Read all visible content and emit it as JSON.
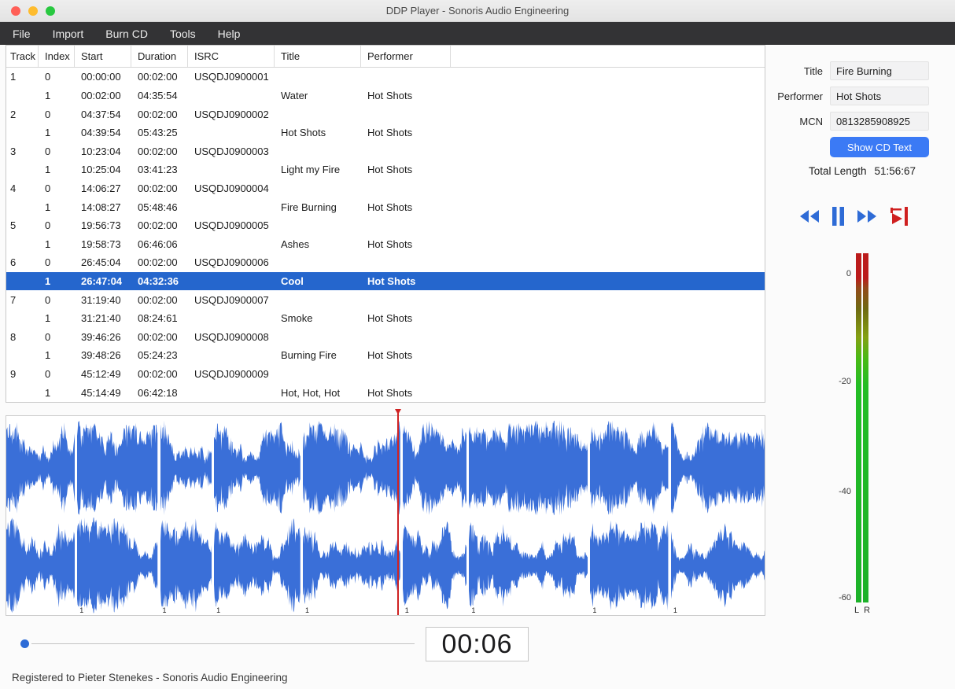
{
  "window": {
    "title": "DDP Player - Sonoris Audio Engineering"
  },
  "menu": {
    "items": [
      "File",
      "Import",
      "Burn CD",
      "Tools",
      "Help"
    ]
  },
  "table": {
    "columns": [
      "Track",
      "Index",
      "Start",
      "Duration",
      "ISRC",
      "Title",
      "Performer"
    ],
    "rows": [
      {
        "track": "1",
        "index": "0",
        "start": "00:00:00",
        "duration": "00:02:00",
        "isrc": "USQDJ0900001",
        "title": "",
        "performer": "",
        "selected": false
      },
      {
        "track": "",
        "index": "1",
        "start": "00:02:00",
        "duration": "04:35:54",
        "isrc": "",
        "title": "Water",
        "performer": "Hot Shots",
        "selected": false
      },
      {
        "track": "2",
        "index": "0",
        "start": "04:37:54",
        "duration": "00:02:00",
        "isrc": "USQDJ0900002",
        "title": "",
        "performer": "",
        "selected": false
      },
      {
        "track": "",
        "index": "1",
        "start": "04:39:54",
        "duration": "05:43:25",
        "isrc": "",
        "title": "Hot Shots",
        "performer": "Hot Shots",
        "selected": false
      },
      {
        "track": "3",
        "index": "0",
        "start": "10:23:04",
        "duration": "00:02:00",
        "isrc": "USQDJ0900003",
        "title": "",
        "performer": "",
        "selected": false
      },
      {
        "track": "",
        "index": "1",
        "start": "10:25:04",
        "duration": "03:41:23",
        "isrc": "",
        "title": "Light my Fire",
        "performer": "Hot Shots",
        "selected": false
      },
      {
        "track": "4",
        "index": "0",
        "start": "14:06:27",
        "duration": "00:02:00",
        "isrc": "USQDJ0900004",
        "title": "",
        "performer": "",
        "selected": false
      },
      {
        "track": "",
        "index": "1",
        "start": "14:08:27",
        "duration": "05:48:46",
        "isrc": "",
        "title": "Fire Burning",
        "performer": "Hot Shots",
        "selected": false
      },
      {
        "track": "5",
        "index": "0",
        "start": "19:56:73",
        "duration": "00:02:00",
        "isrc": "USQDJ0900005",
        "title": "",
        "performer": "",
        "selected": false
      },
      {
        "track": "",
        "index": "1",
        "start": "19:58:73",
        "duration": "06:46:06",
        "isrc": "",
        "title": "Ashes",
        "performer": "Hot Shots",
        "selected": false
      },
      {
        "track": "6",
        "index": "0",
        "start": "26:45:04",
        "duration": "00:02:00",
        "isrc": "USQDJ0900006",
        "title": "",
        "performer": "",
        "selected": false
      },
      {
        "track": "",
        "index": "1",
        "start": "26:47:04",
        "duration": "04:32:36",
        "isrc": "",
        "title": "Cool",
        "performer": "Hot Shots",
        "selected": true
      },
      {
        "track": "7",
        "index": "0",
        "start": "31:19:40",
        "duration": "00:02:00",
        "isrc": "USQDJ0900007",
        "title": "",
        "performer": "",
        "selected": false
      },
      {
        "track": "",
        "index": "1",
        "start": "31:21:40",
        "duration": "08:24:61",
        "isrc": "",
        "title": "Smoke",
        "performer": "Hot Shots",
        "selected": false
      },
      {
        "track": "8",
        "index": "0",
        "start": "39:46:26",
        "duration": "00:02:00",
        "isrc": "USQDJ0900008",
        "title": "",
        "performer": "",
        "selected": false
      },
      {
        "track": "",
        "index": "1",
        "start": "39:48:26",
        "duration": "05:24:23",
        "isrc": "",
        "title": "Burning Fire",
        "performer": "Hot Shots",
        "selected": false
      },
      {
        "track": "9",
        "index": "0",
        "start": "45:12:49",
        "duration": "00:02:00",
        "isrc": "USQDJ0900009",
        "title": "",
        "performer": "",
        "selected": false
      },
      {
        "track": "",
        "index": "1",
        "start": "45:14:49",
        "duration": "06:42:18",
        "isrc": "",
        "title": "Hot, Hot, Hot",
        "performer": "Hot Shots",
        "selected": false
      }
    ]
  },
  "panel": {
    "fields": [
      {
        "label": "Title",
        "value": "Fire Burning"
      },
      {
        "label": "Performer",
        "value": "Hot Shots"
      },
      {
        "label": "MCN",
        "value": "0813285908925"
      }
    ],
    "show_cd_text_label": "Show CD Text",
    "total_length_label": "Total Length",
    "total_length_value": "51:56:67"
  },
  "transport_icons": [
    "rewind",
    "pause",
    "fast-forward",
    "play-to-marker"
  ],
  "meter": {
    "scale": [
      "0",
      "-20",
      "-40",
      "-60"
    ],
    "channels": [
      "L",
      "R"
    ]
  },
  "waveform": {
    "color": "#3a6fd8",
    "playhead_pct": 51.6,
    "seed": 42,
    "segments": [
      {
        "width": 9.3,
        "label": ""
      },
      {
        "width": 10.9,
        "label": "1"
      },
      {
        "width": 7.0,
        "label": "1"
      },
      {
        "width": 11.7,
        "label": "1"
      },
      {
        "width": 13.2,
        "label": "1"
      },
      {
        "width": 8.7,
        "label": "1"
      },
      {
        "width": 16.1,
        "label": "1"
      },
      {
        "width": 10.6,
        "label": "1"
      },
      {
        "width": 12.7,
        "label": "1"
      }
    ]
  },
  "transportbar": {
    "time": "00:06",
    "slider_pct": 0
  },
  "statusbar": {
    "text": "Registered to Pieter Stenekes - Sonoris Audio Engineering"
  }
}
